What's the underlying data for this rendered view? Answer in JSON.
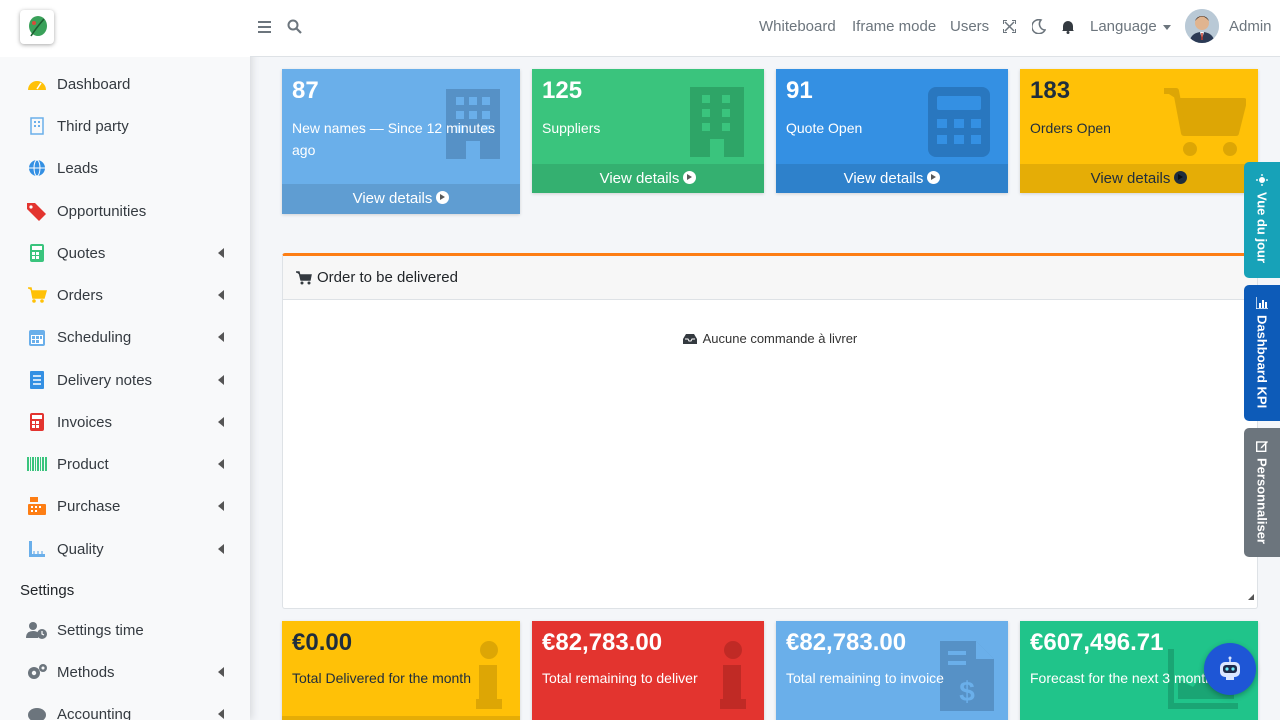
{
  "sidebar": {
    "items": [
      {
        "label": "Dashboard",
        "icon": "gauge-icon",
        "chevron": false
      },
      {
        "label": "Third party",
        "icon": "building-icon",
        "chevron": false
      },
      {
        "label": "Leads",
        "icon": "globe-icon",
        "chevron": false
      },
      {
        "label": "Opportunities",
        "icon": "tags-icon",
        "chevron": false
      },
      {
        "label": "Quotes",
        "icon": "calculator-icon",
        "chevron": true
      },
      {
        "label": "Orders",
        "icon": "cart-icon",
        "chevron": true
      },
      {
        "label": "Scheduling",
        "icon": "calendar-icon",
        "chevron": true
      },
      {
        "label": "Delivery notes",
        "icon": "document-icon",
        "chevron": true
      },
      {
        "label": "Invoices",
        "icon": "calculator-icon",
        "chevron": true
      },
      {
        "label": "Product",
        "icon": "barcode-icon",
        "chevron": true
      },
      {
        "label": "Purchase",
        "icon": "cash-register-icon",
        "chevron": true
      },
      {
        "label": "Quality",
        "icon": "ruler-icon",
        "chevron": true
      }
    ],
    "settings_header": "Settings",
    "settings_items": [
      {
        "label": "Settings time",
        "icon": "user-clock-icon",
        "chevron": false
      },
      {
        "label": "Methods",
        "icon": "cogs-icon",
        "chevron": true
      },
      {
        "label": "Accounting",
        "icon": "piggy-bank-icon",
        "chevron": true
      }
    ]
  },
  "topbar": {
    "links": [
      "Whiteboard",
      "Iframe mode",
      "Users"
    ],
    "language": "Language",
    "user": "Admin"
  },
  "stats": [
    {
      "value": "87",
      "label": "New names — Since 12 minutes ago",
      "footer": "View details",
      "color": "#6aafea"
    },
    {
      "value": "125",
      "label": "Suppliers",
      "footer": "View details",
      "color": "#3ac47d"
    },
    {
      "value": "91",
      "label": "Quote Open",
      "footer": "View details",
      "color": "#3490e3"
    },
    {
      "value": "183",
      "label": "Orders Open",
      "footer": "View details",
      "color": "#ffc107"
    }
  ],
  "card": {
    "title": "Order to be delivered",
    "empty": "Aucune commande à livrer"
  },
  "totals": [
    {
      "value": "€0.00",
      "label": "Total Delivered for the month",
      "color": "#ffc107"
    },
    {
      "value": "€82,783.00",
      "label": "Total remaining to deliver",
      "color": "#e3342f"
    },
    {
      "value": "€82,783.00",
      "label": "Total remaining to invoice",
      "color": "#6aafea"
    },
    {
      "value": "€607,496.71",
      "label": "Forecast for the next 3 months",
      "color": "#20c48a"
    }
  ],
  "right_tabs": [
    {
      "label": "Vue du jour",
      "icon": "sun-icon",
      "color": "#17a2b8"
    },
    {
      "label": "Dashboard KPI",
      "icon": "chart-icon",
      "color": "#0d5bb8"
    },
    {
      "label": "Personnaliser",
      "icon": "edit-icon",
      "color": "#6c757d"
    }
  ]
}
